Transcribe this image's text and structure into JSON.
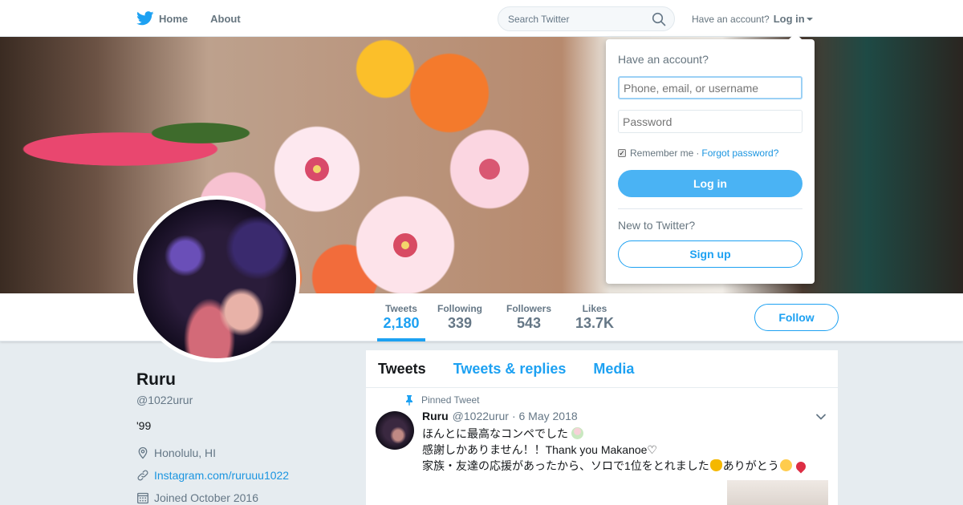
{
  "nav": {
    "home": "Home",
    "about": "About",
    "search_placeholder": "Search Twitter",
    "have_account": "Have an account?",
    "login": "Log in"
  },
  "profile_nav": {
    "stats": [
      {
        "label": "Tweets",
        "value": "2,180"
      },
      {
        "label": "Following",
        "value": "339"
      },
      {
        "label": "Followers",
        "value": "543"
      },
      {
        "label": "Likes",
        "value": "13.7K"
      }
    ],
    "follow": "Follow"
  },
  "profile": {
    "name": "Ruru",
    "screen_name": "@1022urur",
    "bio": "'99",
    "location": "Honolulu, HI",
    "website": "Instagram.com/ruruuu1022",
    "joined": "Joined October 2016"
  },
  "timeline": {
    "tabs": [
      "Tweets",
      "Tweets & replies",
      "Media"
    ],
    "tweet": {
      "pinned": "Pinned Tweet",
      "name": "Ruru",
      "screen_name": "@1022urur",
      "date": "· 6 May 2018",
      "line1": "ほんとに最高なコンペでした",
      "line2": "感謝しかありません！！Thank you Makanoe♡",
      "line3a": "家族・友達の応援があったから、ソロで1位をとれました",
      "line3b": "ありがとう"
    }
  },
  "login_dropdown": {
    "title": "Have an account?",
    "username_placeholder": "Phone, email, or username",
    "password_placeholder": "Password",
    "remember": "Remember me",
    "separator": "·",
    "forgot": "Forgot password?",
    "login_button": "Log in",
    "new_to_twitter": "New to Twitter?",
    "signup_button": "Sign up"
  },
  "colors": {
    "accent": "#1da1f2",
    "link": "#1b95e0",
    "login_button": "#4ab3f4",
    "background": "#e6ecf0"
  }
}
